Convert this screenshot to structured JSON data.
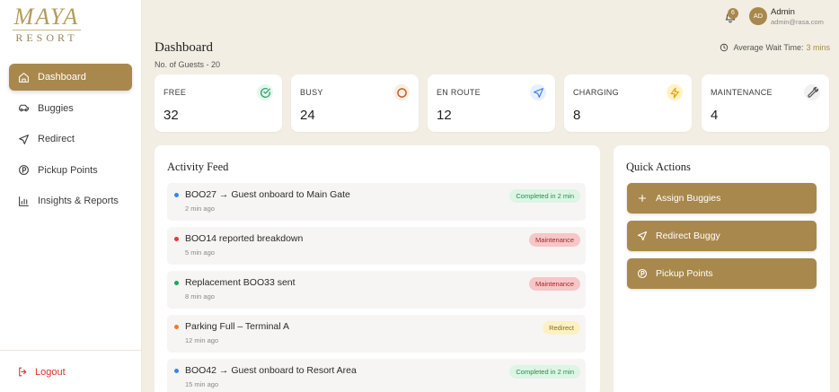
{
  "brand": {
    "name": "MAYA",
    "sub": "RESORT"
  },
  "sidebar": {
    "items": [
      {
        "label": "Dashboard",
        "icon": "home-icon"
      },
      {
        "label": "Buggies",
        "icon": "buggy-icon"
      },
      {
        "label": "Redirect",
        "icon": "navigation-icon"
      },
      {
        "label": "Pickup Points",
        "icon": "parking-icon"
      },
      {
        "label": "Insights & Reports",
        "icon": "bar-chart-icon"
      }
    ],
    "logout_label": "Logout"
  },
  "topbar": {
    "notifications": "6",
    "avatar_initials": "AD",
    "user_name": "Admin",
    "user_email": "admin@rasa.com"
  },
  "header": {
    "title": "Dashboard",
    "guests": "No. of Guests - 20",
    "wait_label": "Average Wait Time:",
    "wait_value": "3 mins"
  },
  "stats": [
    {
      "label": "FREE",
      "value": "32",
      "icon": "check-circle-icon",
      "color": "#2ea36a"
    },
    {
      "label": "BUSY",
      "value": "24",
      "icon": "circle-icon",
      "color": "#c2571c"
    },
    {
      "label": "EN ROUTE",
      "value": "12",
      "icon": "navigation-icon",
      "color": "#3b82f6"
    },
    {
      "label": "CHARGING",
      "value": "8",
      "icon": "lightning-icon",
      "color": "#e0a800"
    },
    {
      "label": "MAINTENANCE",
      "value": "4",
      "icon": "wrench-icon",
      "color": "#555555"
    }
  ],
  "feed": {
    "title": "Activity Feed",
    "items": [
      {
        "text": "BOO27 → Guest onboard to Main Gate",
        "time": "2 min ago",
        "badge": "Completed in 2 min",
        "dot": "#3b82f6"
      },
      {
        "text": "BOO14 reported breakdown",
        "time": "5 min ago",
        "badge": "Maintenance",
        "dot": "#e53935"
      },
      {
        "text": "Replacement BOO33 sent",
        "time": "8 min ago",
        "badge": "Maintenance",
        "dot": "#22a55a"
      },
      {
        "text": "Parking Full – Terminal A",
        "time": "12 min ago",
        "badge": "Redirect",
        "dot": "#f07a22"
      },
      {
        "text": "BOO42 → Guest onboard to Resort Area",
        "time": "15 min ago",
        "badge": "Completed in 2 min",
        "dot": "#3b82f6"
      }
    ]
  },
  "quick_actions": {
    "title": "Quick Actions",
    "buttons": [
      {
        "label": "Assign Buggies",
        "icon": "plus-icon"
      },
      {
        "label": "Redirect Buggy",
        "icon": "navigation-icon"
      },
      {
        "label": "Pickup Points",
        "icon": "parking-icon"
      }
    ]
  },
  "colors": {
    "accent": "#a8884c",
    "background": "#f3eee4",
    "badge_completed_bg": "#dcf5e4",
    "badge_completed_fg": "#2e8a4f",
    "badge_maintenance_bg": "#f7c6c6",
    "badge_maintenance_fg": "#9b2a2a",
    "badge_redirect_bg": "#fbf1c4",
    "badge_redirect_fg": "#8a6d14"
  }
}
